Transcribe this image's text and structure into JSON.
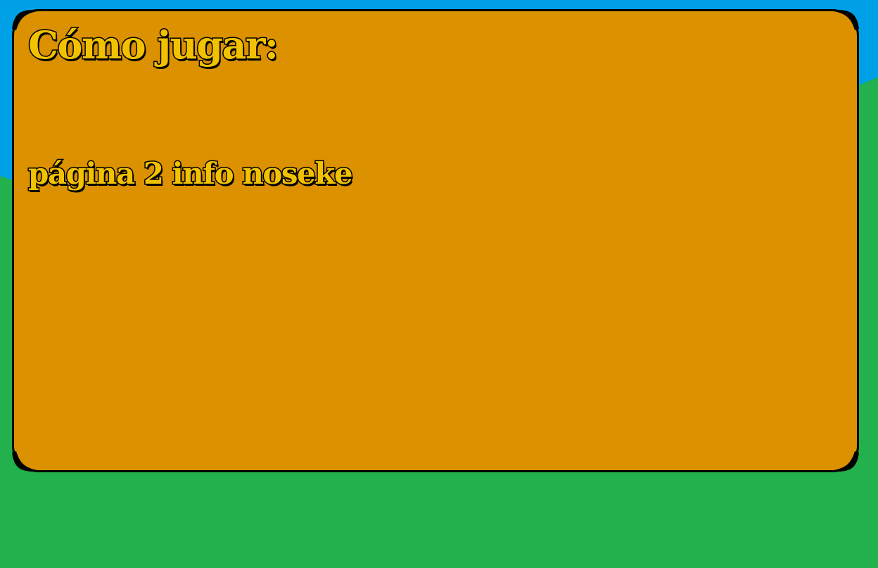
{
  "colors": {
    "sky": "#00a0e6",
    "grass": "#22b14c",
    "panel": "#db9100",
    "panel_border": "#000000",
    "text_fill": "#f2c200",
    "text_outline": "#000000"
  },
  "panel": {
    "title": "Cómo jugar:",
    "body": "página 2 info noseke"
  }
}
